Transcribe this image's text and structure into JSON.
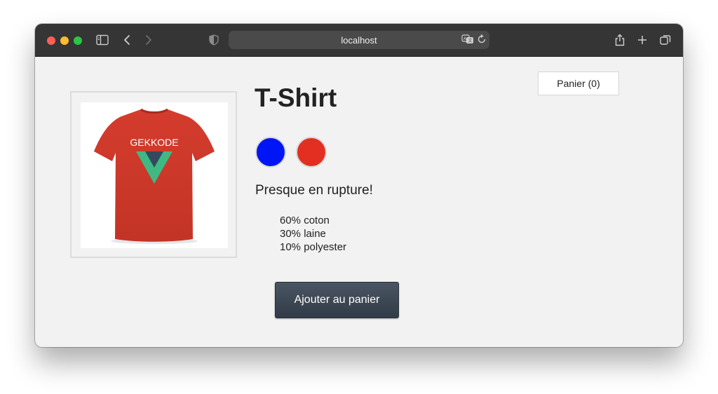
{
  "browser": {
    "url": "localhost",
    "icons": [
      "sidebar-icon",
      "back-icon",
      "forward-icon",
      "shield-icon",
      "translate-icon",
      "reload-icon",
      "share-icon",
      "new-tab-icon",
      "tabs-overview-icon"
    ]
  },
  "cart": {
    "label": "Panier (0)"
  },
  "product": {
    "title": "T-Shirt",
    "image_text": "GEKKODE",
    "colors": [
      {
        "name": "blue",
        "hex": "#0015f5"
      },
      {
        "name": "red",
        "hex": "#e32f22"
      }
    ],
    "stock_status": "Presque en rupture!",
    "details": [
      "60% coton",
      "30% laine",
      "10% polyester"
    ],
    "add_button": "Ajouter au panier"
  },
  "colors": {
    "shirt": "#d0392b",
    "logo_green": "#3fb984",
    "logo_dark": "#35495e",
    "button_bg": "#3e4855"
  }
}
